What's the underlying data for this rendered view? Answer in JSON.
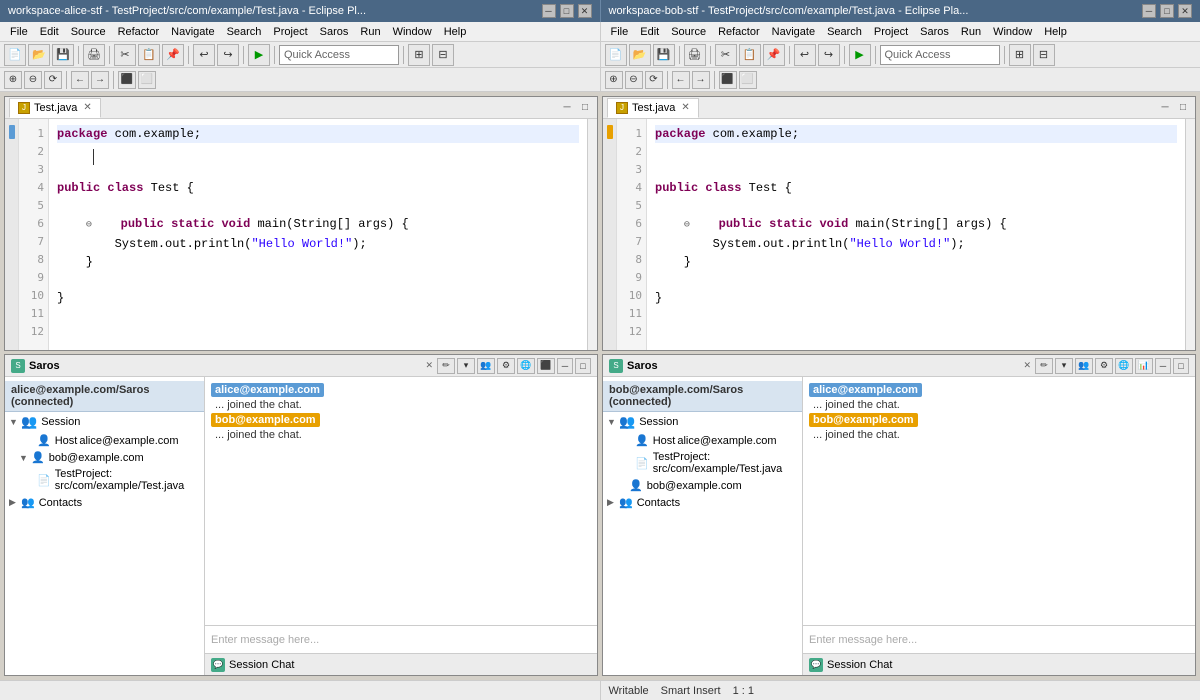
{
  "left_window": {
    "title": "workspace-alice-stf - TestProject/src/com/example/Test.java - Eclipse Pl...",
    "menu_items": [
      "File",
      "Edit",
      "Source",
      "Refactor",
      "Navigate",
      "Search",
      "Project",
      "Saros",
      "Run",
      "Window",
      "Help"
    ],
    "quick_access_placeholder": "Quick Access",
    "editor_tab": "Test.java",
    "code_lines": [
      "",
      "package com.example;",
      "",
      "",
      "public class Test {",
      "",
      "    public static void main(String[] args) {",
      "        System.out.println(\"Hello World!\");",
      "    }",
      "",
      "}",
      ""
    ],
    "saros_title": "Saros",
    "connection_status": "alice@example.com/Saros (connected)",
    "session_label": "Session",
    "host_label": "Host",
    "host_user": "alice@example.com",
    "bob_user": "bob@example.com",
    "file_path": "TestProject: src/com/example/Test.java",
    "contacts_label": "Contacts",
    "chat_alice_tag": "alice@example.com",
    "chat_bob_tag": "bob@example.com",
    "chat_message1": "... joined the chat.",
    "chat_message2": "... joined the chat.",
    "chat_input_placeholder": "Enter message here...",
    "session_chat_label": "Session Chat"
  },
  "right_window": {
    "title": "workspace-bob-stf - TestProject/src/com/example/Test.java - Eclipse Pla...",
    "menu_items": [
      "File",
      "Edit",
      "Source",
      "Refactor",
      "Navigate",
      "Search",
      "Project",
      "Saros",
      "Run",
      "Window",
      "Help"
    ],
    "quick_access_placeholder": "Quick Access",
    "editor_tab": "Test.java",
    "code_lines": [
      "",
      "package com.example;",
      "",
      "",
      "public class Test {",
      "",
      "    public static void main(String[] args) {",
      "        System.out.println(\"Hello World!\");",
      "    }",
      "",
      "}",
      ""
    ],
    "saros_title": "Saros",
    "connection_status": "bob@example.com/Saros (connected)",
    "session_label": "Session",
    "host_label": "Host",
    "host_user": "alice@example.com",
    "file_path": "TestProject: src/com/example/Test.java",
    "bob_user": "bob@example.com",
    "contacts_label": "Contacts",
    "chat_alice_tag": "alice@example.com",
    "chat_bob_tag": "bob@example.com",
    "chat_message1": "... joined the chat.",
    "chat_message2": "... joined the chat.",
    "chat_input_placeholder": "Enter message here...",
    "session_chat_label": "Session Chat",
    "status_writable": "Writable",
    "status_smart_insert": "Smart Insert",
    "status_pos": "1 : 1"
  },
  "icons": {
    "close": "✕",
    "minimize": "─",
    "maximize": "□",
    "collapse": "▼",
    "expand": "▶",
    "arrow_down": "▾",
    "folder": "📁",
    "file_java": "J",
    "person": "👤",
    "persons": "👥",
    "chat_bubble": "💬"
  }
}
